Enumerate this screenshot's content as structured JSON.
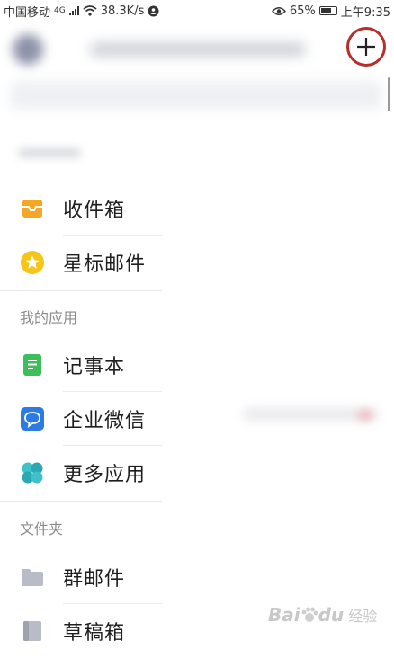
{
  "status": {
    "carrier": "中国移动",
    "net_type": "4G",
    "speed": "38.3K/s",
    "battery": "65%",
    "time": "上午9:35"
  },
  "menu": {
    "inbox": "收件箱",
    "starred": "星标邮件",
    "apps_header": "我的应用",
    "notes": "记事本",
    "wework": "企业微信",
    "more_apps": "更多应用",
    "folders_header": "文件夹",
    "group_mail": "群邮件",
    "drafts": "草稿箱"
  },
  "watermark": {
    "brand": "Bai",
    "brand2": "du",
    "suffix": "经验"
  },
  "colors": {
    "inbox": "#f5a623",
    "starred": "#f5c518",
    "notes": "#3cbf5a",
    "wework": "#2c7be5",
    "more_apps": "#3fc1c9",
    "folder": "#b8bcc6",
    "highlight_circle": "#b5302a"
  }
}
